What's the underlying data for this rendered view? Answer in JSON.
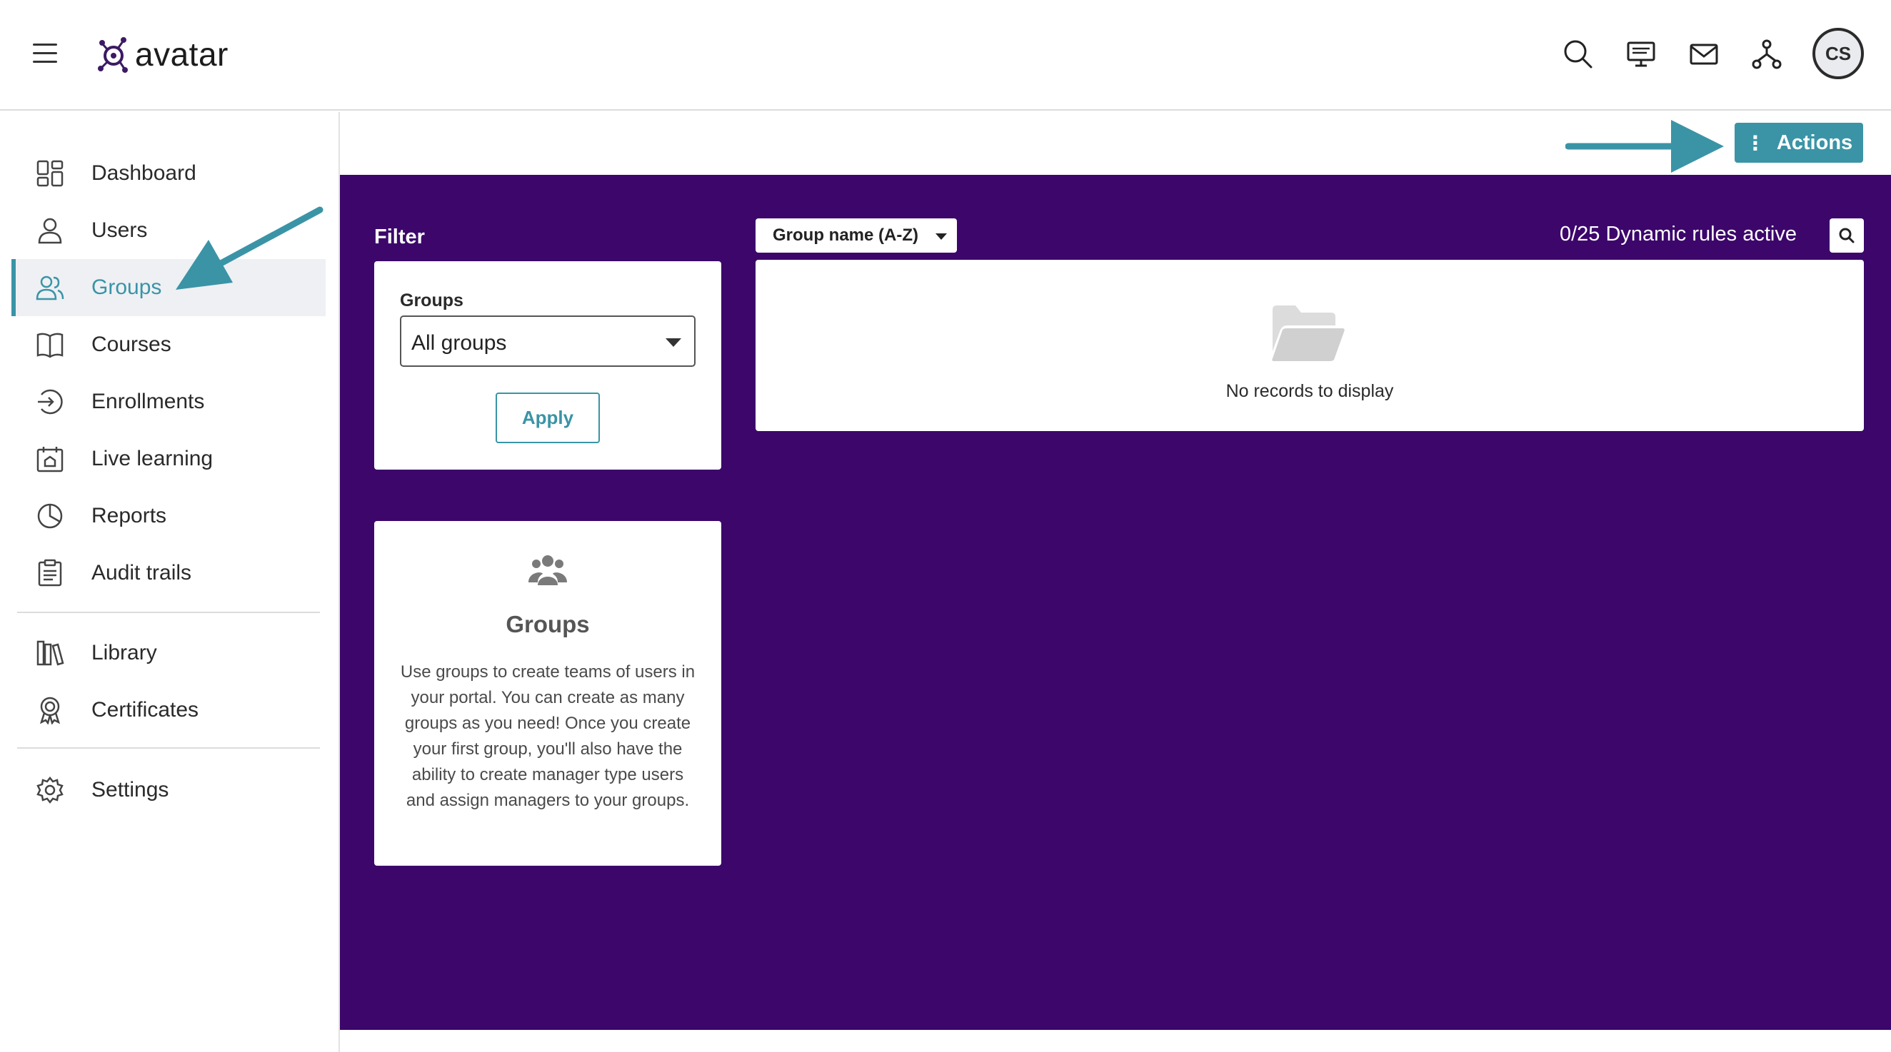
{
  "header": {
    "logo_text": "avatar",
    "user_initials": "CS",
    "icons": [
      "search-icon",
      "presentation-icon",
      "mail-icon",
      "network-icon"
    ]
  },
  "sidebar": {
    "items": [
      {
        "label": "Dashboard",
        "icon": "dashboard-icon"
      },
      {
        "label": "Users",
        "icon": "user-icon"
      },
      {
        "label": "Groups",
        "icon": "groups-icon",
        "active": true
      },
      {
        "label": "Courses",
        "icon": "book-icon"
      },
      {
        "label": "Enrollments",
        "icon": "enroll-icon"
      },
      {
        "label": "Live learning",
        "icon": "calendar-icon"
      },
      {
        "label": "Reports",
        "icon": "pie-chart-icon"
      },
      {
        "label": "Audit trails",
        "icon": "clipboard-icon"
      },
      {
        "label": "Library",
        "icon": "library-icon"
      },
      {
        "label": "Certificates",
        "icon": "certificate-icon"
      },
      {
        "label": "Settings",
        "icon": "gear-icon"
      }
    ]
  },
  "toolbar": {
    "actions_label": "Actions"
  },
  "filter": {
    "title": "Filter",
    "groups_label": "Groups",
    "groups_value": "All groups",
    "apply_label": "Apply"
  },
  "info": {
    "title": "Groups",
    "description": "Use groups to create teams of users in your portal. You can create as many groups as you need! Once you create your first group, you'll also have the ability to create manager type users and assign managers to your groups."
  },
  "list": {
    "sort_label": "Group name (A-Z)",
    "rules_status": "0/25 Dynamic rules active",
    "empty_text": "No records to display"
  },
  "colors": {
    "accent": "#3a94a6",
    "content_bg": "#3c066b",
    "active_bg": "#eef0f4"
  }
}
